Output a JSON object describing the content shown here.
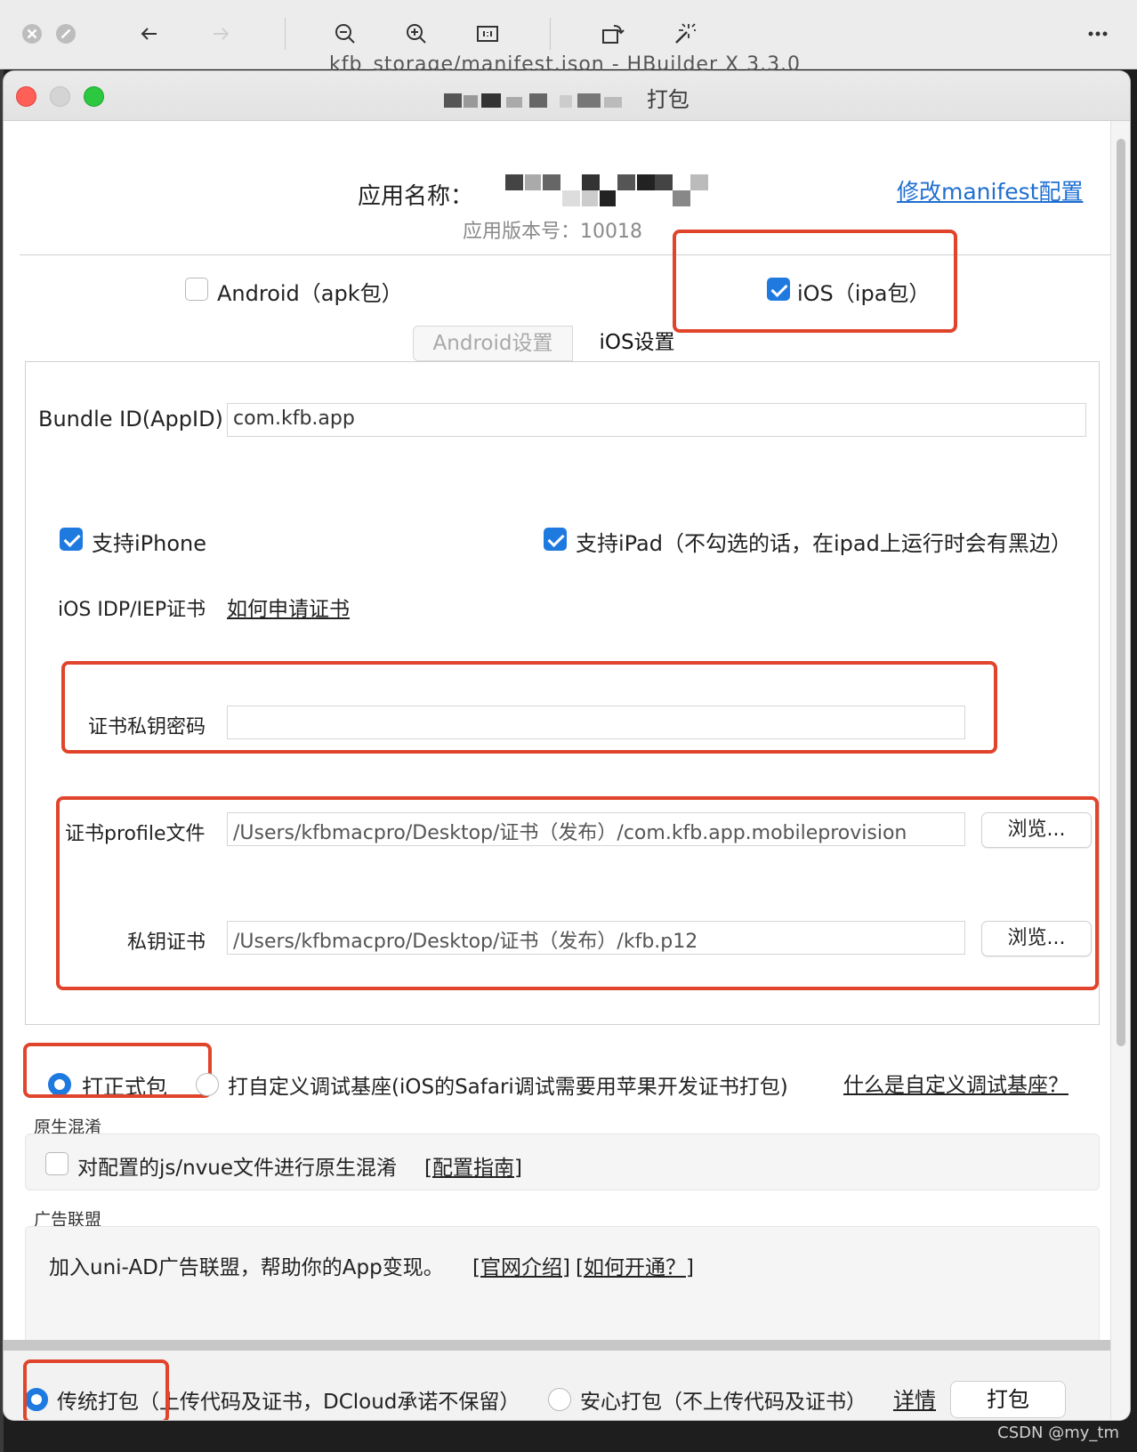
{
  "viewer": {
    "title": "kfb_storage/manifest.json - HBuilder X 3.3.0"
  },
  "window": {
    "title_suffix": "打包"
  },
  "app": {
    "name_label": "应用名称：",
    "version_label": "应用版本号：10018",
    "manifest_link": "修改manifest配置"
  },
  "platforms": {
    "android_label": "Android（apk包）",
    "ios_label": "iOS（ipa包）",
    "android_checked": false,
    "ios_checked": true
  },
  "tabs": [
    {
      "label": "Android设置",
      "active": false
    },
    {
      "label": "iOS设置",
      "active": true
    }
  ],
  "ios": {
    "bundle_label": "Bundle ID(AppID)",
    "bundle_value": "com.kfb.app",
    "iphone_label": "支持iPhone",
    "ipad_label": "支持iPad（不勾选的话，在ipad上运行时会有黑边）",
    "cert_title": "iOS IDP/IEP证书",
    "cert_link": "如何申请证书",
    "key_password_label": "证书私钥密码",
    "key_password_value": "",
    "profile_label": "证书profile文件",
    "profile_value": "/Users/kfbmacpro/Desktop/证书（发布）/com.kfb.app.mobileprovision",
    "private_key_label": "私钥证书",
    "private_key_value": "/Users/kfbmacpro/Desktop/证书（发布）/kfb.p12",
    "browse_label": "浏览..."
  },
  "build_mode": {
    "release_label": "打正式包",
    "custom_label": "打自定义调试基座(iOS的Safari调试需要用苹果开发证书打包)",
    "custom_link": "什么是自定义调试基座？"
  },
  "obfuscation": {
    "title": "原生混淆",
    "checkbox_label": "对配置的js/nvue文件进行原生混淆",
    "link": "[配置指南]"
  },
  "ads": {
    "title": "广告联盟",
    "text": "加入uni-AD广告联盟，帮助你的App变现。",
    "link1": "[官网介绍]",
    "link2": "[如何开通？]"
  },
  "packaging": {
    "traditional_label": "传统打包（上传代码及证书，DCloud承诺不保留）",
    "safe_label": "安心打包（不上传代码及证书）",
    "details_link": "详情",
    "pack_button": "打包"
  },
  "watermark": "CSDN @my_tm",
  "colors": {
    "accent": "#1f7ae0",
    "link": "#1f6fd1",
    "highlight": "#e0452c"
  }
}
